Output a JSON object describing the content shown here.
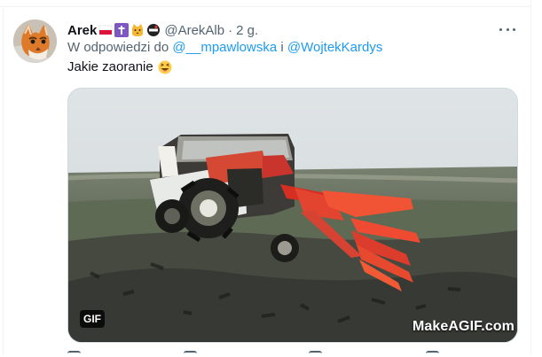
{
  "tweet": {
    "display_name": "Arek",
    "handle": "@ArekAlb",
    "separator": "·",
    "timestamp": "2 g.",
    "reply_prefix": "W odpowiedzi do",
    "mention_one": "@__mpawlowska",
    "mention_joiner": "i",
    "mention_two": "@WojtekKardys",
    "text": "Jakie zaoranie",
    "media": {
      "badge": "GIF",
      "watermark": "MakeAGIF.com"
    },
    "header_icons": [
      "poland-flag-icon",
      "latin-cross-icon",
      "cat-face-icon",
      "no-entry-icon"
    ],
    "content_icon": "laughing-face-icon"
  }
}
